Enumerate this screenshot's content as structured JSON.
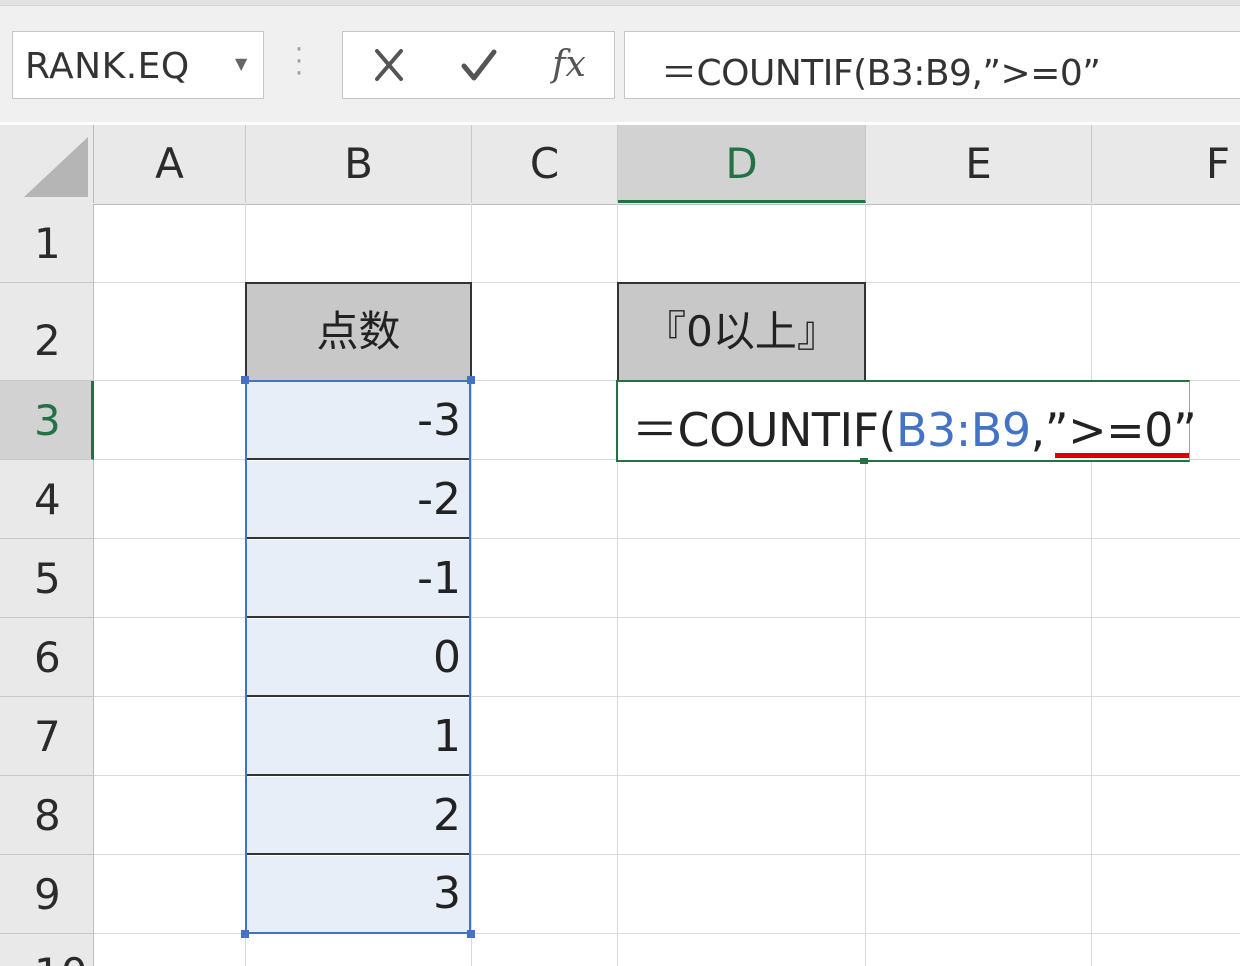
{
  "toolbar": {
    "name_box": "RANK.EQ",
    "formula": "＝COUNTIF(B3:B9,”>=0”"
  },
  "columns": [
    "A",
    "B",
    "C",
    "D",
    "E",
    "F"
  ],
  "rows": [
    "1",
    "2",
    "3",
    "4",
    "5",
    "6",
    "7",
    "8",
    "9",
    "10"
  ],
  "active_column": "D",
  "active_row": "3",
  "cells": {
    "B2": "点数",
    "D2": "『0以上』",
    "B_values": [
      "-3",
      "-2",
      "-1",
      "0",
      "1",
      "2",
      "3"
    ]
  },
  "editing": {
    "prefix": "＝COUNTIF(",
    "ref": "B3:B9",
    "suffix": ",”>=0”"
  },
  "colors": {
    "accent_green": "#217346",
    "selection_blue": "#4472c4",
    "underline_red": "#e00000"
  },
  "icons": [
    "cancel-icon",
    "enter-icon",
    "fx-icon",
    "dropdown-icon"
  ]
}
